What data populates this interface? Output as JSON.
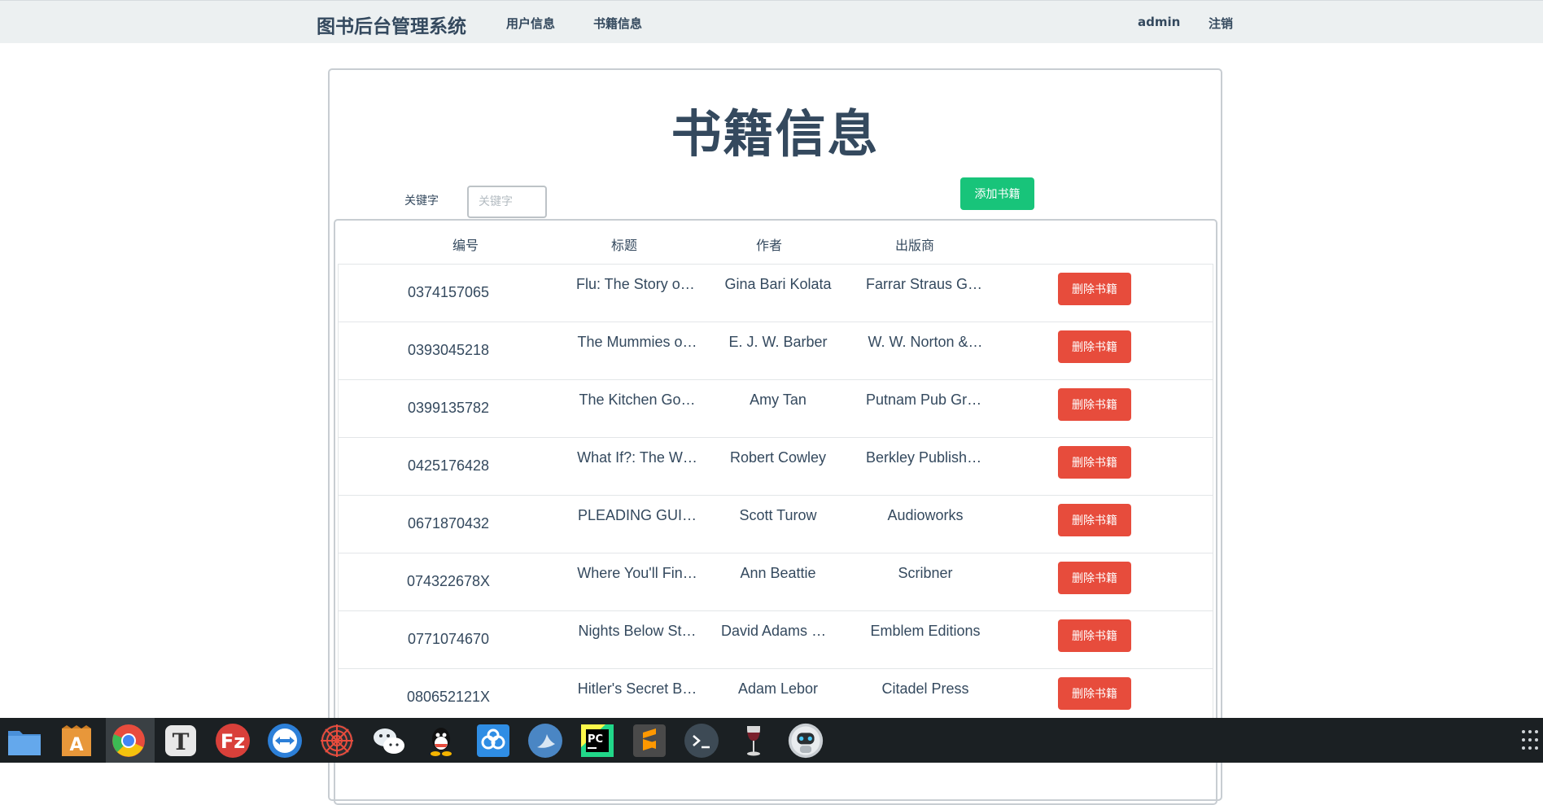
{
  "navbar": {
    "brand": "图书后台管理系统",
    "links": [
      "用户信息",
      "书籍信息"
    ],
    "user": "admin",
    "logout": "注销"
  },
  "page": {
    "title": "书籍信息",
    "keyword_label": "关键字",
    "keyword_placeholder": "关键字",
    "keyword_value": "",
    "add_button": "添加书籍"
  },
  "table": {
    "headers": [
      "编号",
      "标题",
      "作者",
      "出版商"
    ],
    "delete_label": "删除书籍",
    "rows": [
      {
        "id": "0374157065",
        "title": "Flu: The Story of…",
        "author": "Gina Bari Kolata",
        "publisher": "Farrar Straus Gi…"
      },
      {
        "id": "0393045218",
        "title": "The Mummies o…",
        "author": "E. J. W. Barber",
        "publisher": "W. W. Norton &…"
      },
      {
        "id": "0399135782",
        "title": "The Kitchen Go…",
        "author": "Amy Tan",
        "publisher": "Putnam Pub Gro…"
      },
      {
        "id": "0425176428",
        "title": "What If?: The W…",
        "author": "Robert Cowley",
        "publisher": "Berkley Publishi…"
      },
      {
        "id": "0671870432",
        "title": "PLEADING GUI…",
        "author": "Scott Turow",
        "publisher": "Audioworks"
      },
      {
        "id": "074322678X",
        "title": "Where You'll Fin…",
        "author": "Ann Beattie",
        "publisher": "Scribner"
      },
      {
        "id": "0771074670",
        "title": "Nights Below St…",
        "author": "David Adams Ri…",
        "publisher": "Emblem Editions"
      },
      {
        "id": "080652121X",
        "title": "Hitler's Secret B…",
        "author": "Adam Lebor",
        "publisher": "Citadel Press"
      }
    ]
  },
  "taskbar": {
    "icons": [
      {
        "name": "file-manager-icon",
        "color": "#4a90d9"
      },
      {
        "name": "app-store-icon",
        "color": "#e8973a"
      },
      {
        "name": "chrome-icon",
        "color": "#e84c3d"
      },
      {
        "name": "typora-icon",
        "color": "#e8e8e8"
      },
      {
        "name": "filezilla-icon",
        "color": "#d9403a"
      },
      {
        "name": "teamviewer-icon",
        "color": "#2c7fd8"
      },
      {
        "name": "spider-icon",
        "color": "#2a2f33"
      },
      {
        "name": "wechat-icon",
        "color": "#e8eef2"
      },
      {
        "name": "qq-icon",
        "color": "#1b2023"
      },
      {
        "name": "baidu-netdisk-icon",
        "color": "#2f8de4"
      },
      {
        "name": "deepin-icon",
        "color": "#4a86c4"
      },
      {
        "name": "pycharm-icon",
        "color": "#21d789"
      },
      {
        "name": "sublime-icon",
        "color": "#ff9800"
      },
      {
        "name": "terminal-icon",
        "color": "#3d4a55"
      },
      {
        "name": "wine-icon",
        "color": "#7a1f2b"
      },
      {
        "name": "robot-icon",
        "color": "#c9ced3"
      }
    ]
  }
}
